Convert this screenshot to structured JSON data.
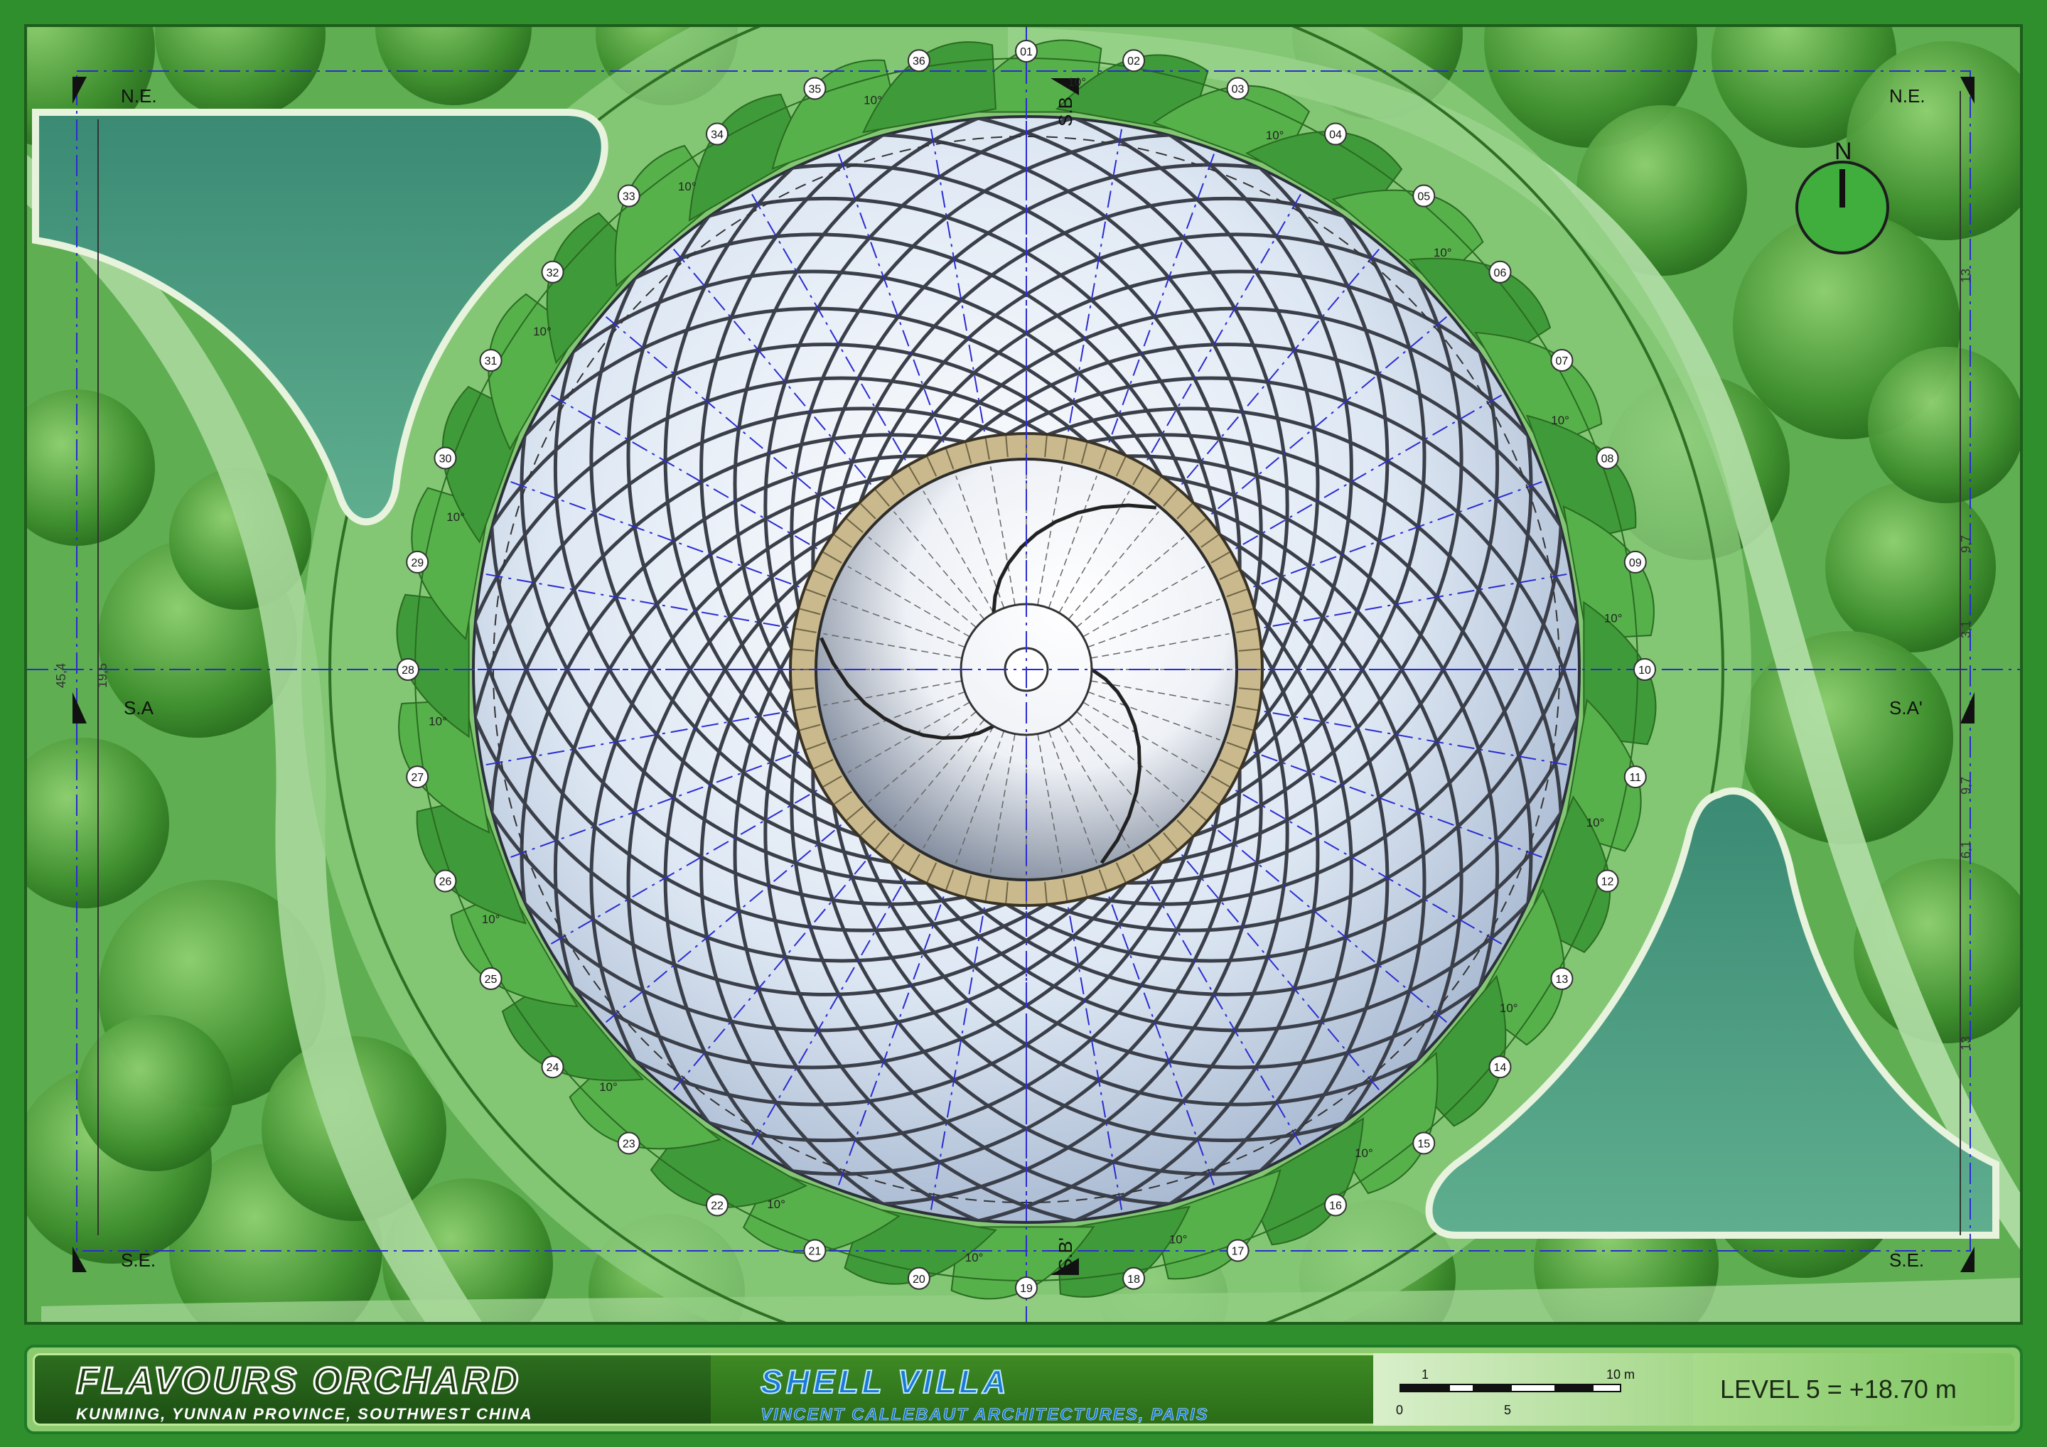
{
  "corner_labels": {
    "top_left": "N.E.",
    "top_right": "N.E.",
    "bottom_left": "S.E.",
    "bottom_right": "S.E."
  },
  "section_labels": {
    "sa_left": "S.A",
    "sa_right": "S.A'",
    "sb_top": "S.B",
    "sb_bottom": "S.B'"
  },
  "north_arrow_label": "N",
  "dimension_labels": {
    "left_total": "45,4",
    "left_segment": "19,5",
    "right_a": "13",
    "right_b": "9,7",
    "right_c": "3,1",
    "right_d": "9,7",
    "right_e": "6,1",
    "right_f": "13",
    "bay_angle": "10°"
  },
  "grid_axes": [
    "01",
    "02",
    "03",
    "04",
    "05",
    "06",
    "07",
    "08",
    "09",
    "10",
    "11",
    "12",
    "13",
    "14",
    "15",
    "16",
    "17",
    "18",
    "19",
    "20",
    "21",
    "22",
    "23",
    "24",
    "25",
    "26",
    "27",
    "28",
    "29",
    "30",
    "31",
    "32",
    "33",
    "34",
    "35",
    "36"
  ],
  "project": {
    "title": "FLAVOURS ORCHARD",
    "location": "KUNMING, YUNNAN PROVINCE, SOUTHWEST CHINA"
  },
  "building": {
    "title": "SHELL VILLA",
    "architect": "VINCENT CALLEBAUT ARCHITECTURES, PARIS"
  },
  "scale_bar": {
    "label_start": "0",
    "label_one": "1",
    "label_five": "5",
    "label_end": "10 m"
  },
  "level": "LEVEL 5 = +18.70 m",
  "colors": {
    "frame": "#2e8f2c",
    "grass": "#5aa94f",
    "path": "#a7d69a",
    "pond": "#4e9a83",
    "dome": "#dfe8f4",
    "ribs": "#3a3f4a",
    "axis": "#2b2bd1"
  }
}
